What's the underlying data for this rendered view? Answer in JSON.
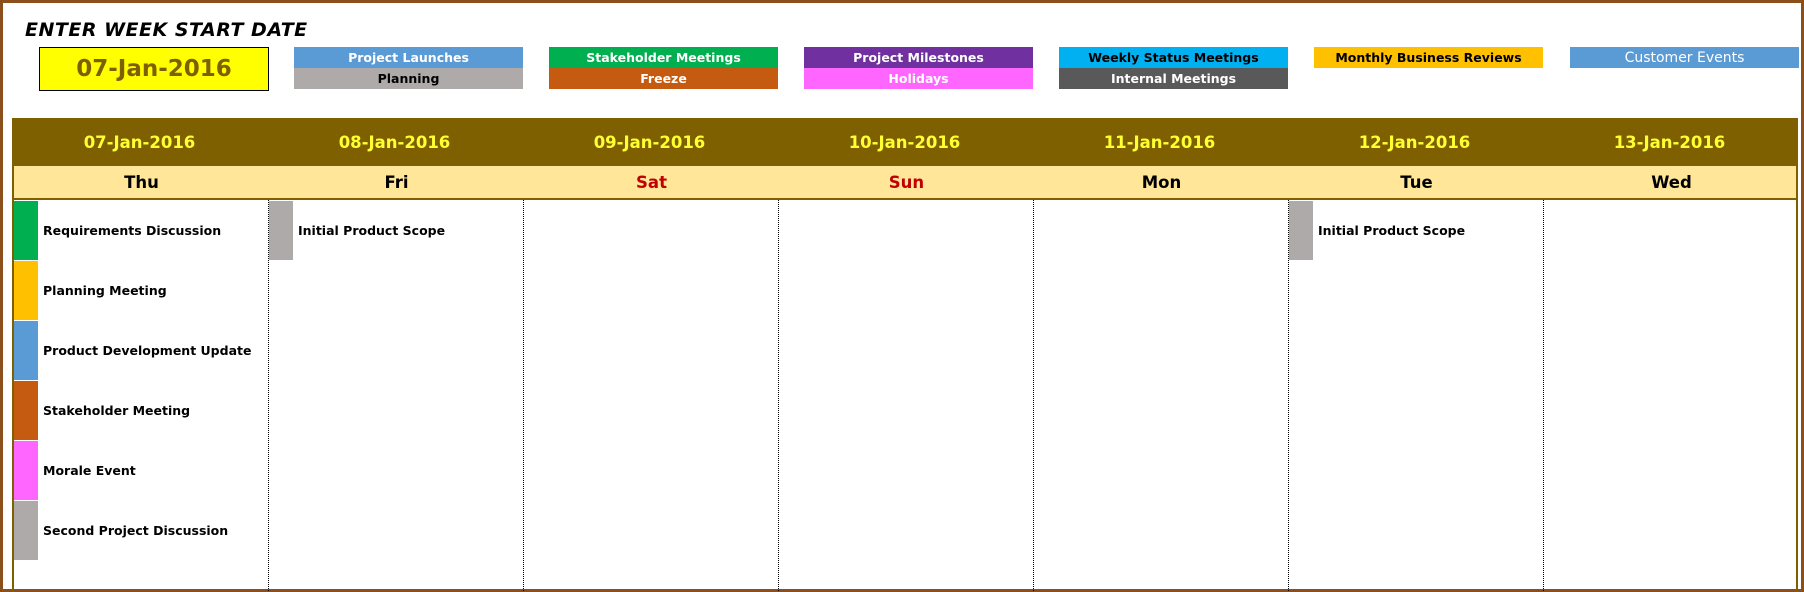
{
  "header": {
    "title": "ENTER WEEK START DATE",
    "week_start_date": "07-Jan-2016"
  },
  "legend": [
    {
      "top": {
        "label": "Project Launches",
        "bg": "#5b9bd5",
        "fg": "#ffffff"
      },
      "bottom": {
        "label": "Planning",
        "bg": "#aeaaaa",
        "fg": "#000000"
      }
    },
    {
      "top": {
        "label": "Stakeholder Meetings",
        "bg": "#00b050",
        "fg": "#ffffff"
      },
      "bottom": {
        "label": "Freeze",
        "bg": "#c55a11",
        "fg": "#ffffff"
      }
    },
    {
      "top": {
        "label": "Project Milestones",
        "bg": "#7030a0",
        "fg": "#ffffff"
      },
      "bottom": {
        "label": "Holidays",
        "bg": "#ff66ff",
        "fg": "#ffffff"
      }
    },
    {
      "top": {
        "label": "Weekly Status Meetings",
        "bg": "#00b0f0",
        "fg": "#000000"
      },
      "bottom": {
        "label": "Internal Meetings",
        "bg": "#595959",
        "fg": "#ffffff"
      }
    },
    {
      "top": {
        "label": "Monthly Business Reviews",
        "bg": "#ffc000",
        "fg": "#000000"
      }
    },
    {
      "top": {
        "label": "Customer Events",
        "bg": "#5b9bd5",
        "fg": "#ffffff"
      }
    }
  ],
  "days": [
    {
      "date": "07-Jan-2016",
      "weekday": "Thu",
      "weekend": false,
      "events": [
        {
          "label": "Requirements Discussion",
          "color": "#00b050"
        },
        {
          "label": "Planning Meeting",
          "color": "#ffc000"
        },
        {
          "label": "Product Development Update",
          "color": "#5b9bd5"
        },
        {
          "label": "Stakeholder Meeting",
          "color": "#c55a11"
        },
        {
          "label": "Morale Event",
          "color": "#ff66ff"
        },
        {
          "label": "Second Project Discussion",
          "color": "#aeaaaa"
        }
      ]
    },
    {
      "date": "08-Jan-2016",
      "weekday": "Fri",
      "weekend": false,
      "events": [
        {
          "label": "Initial Product Scope",
          "color": "#aeaaaa"
        }
      ]
    },
    {
      "date": "09-Jan-2016",
      "weekday": "Sat",
      "weekend": true,
      "events": []
    },
    {
      "date": "10-Jan-2016",
      "weekday": "Sun",
      "weekend": true,
      "events": []
    },
    {
      "date": "11-Jan-2016",
      "weekday": "Mon",
      "weekend": false,
      "events": []
    },
    {
      "date": "12-Jan-2016",
      "weekday": "Tue",
      "weekend": false,
      "events": [
        {
          "label": "Initial Product Scope",
          "color": "#aeaaaa"
        }
      ]
    },
    {
      "date": "13-Jan-2016",
      "weekday": "Wed",
      "weekend": false,
      "events": []
    }
  ],
  "colors": {
    "frame_border": "#8b4f1b",
    "date_band": "#7f6000",
    "date_text": "#ffff33",
    "weekday_band": "#ffe699",
    "weekend_text": "#c00000",
    "input_bg": "#ffff00",
    "input_text": "#7f6000"
  }
}
